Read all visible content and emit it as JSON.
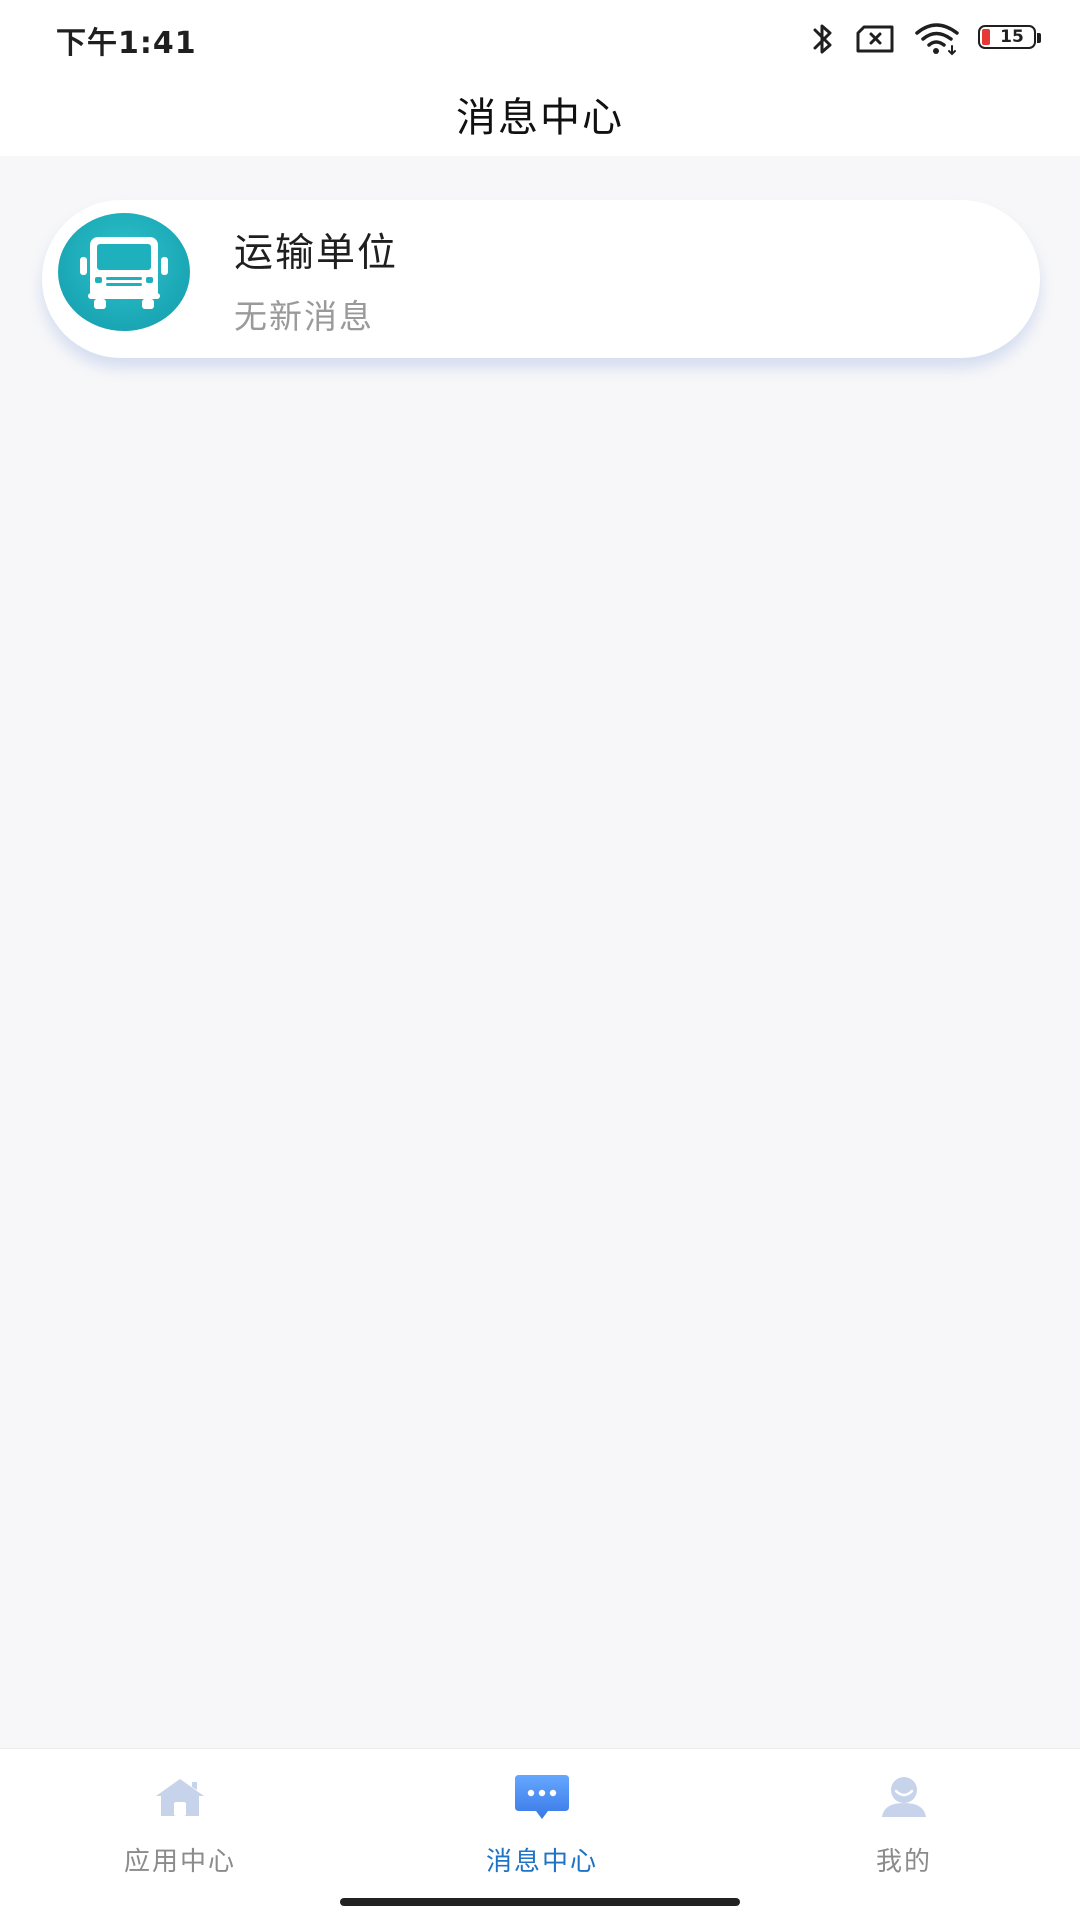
{
  "status_bar": {
    "time": "下午1:41",
    "battery_level": "15",
    "icons": [
      "bluetooth-icon",
      "sim-disabled-icon",
      "wifi-icon",
      "battery-icon"
    ]
  },
  "header": {
    "title": "消息中心"
  },
  "messages": [
    {
      "icon": "truck-icon",
      "title": "运输单位",
      "subtitle": "无新消息"
    }
  ],
  "bottom_nav": {
    "active": 1,
    "items": [
      {
        "label": "应用中心",
        "icon": "home-icon"
      },
      {
        "label": "消息中心",
        "icon": "message-icon"
      },
      {
        "label": "我的",
        "icon": "user-icon"
      }
    ]
  },
  "colors": {
    "accent": "#1f73c5",
    "avatar": "#1aa6b4",
    "background": "#f7f7f9",
    "battery_low": "#e53935"
  }
}
